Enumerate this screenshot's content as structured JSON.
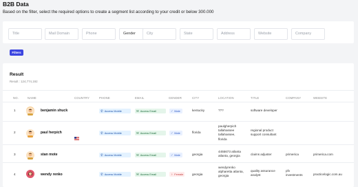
{
  "header": {
    "title": "B2B Data",
    "subtitle": "Based on the filter, select the required options to create a segment list according to your credit or below 300.000"
  },
  "filters": {
    "title": "Title",
    "mail_domain": "Mail Domain",
    "phone": "Phone",
    "gender": "Gender",
    "city": "City",
    "state": "State",
    "address": "Address",
    "website": "Website",
    "company": "Company",
    "button": "Filters"
  },
  "result": {
    "title": "Result",
    "count": "Result : 124,774,192"
  },
  "columns": {
    "no": "NO.",
    "name": "NAME",
    "country": "COUNTRY",
    "phone": "PHONE",
    "email": "EMAIL",
    "gender": "GENDER",
    "city": "CITY",
    "location": "LOCATION",
    "title": "TITLE",
    "company": "COMPANY",
    "website": "WEBSITE"
  },
  "badges": {
    "mobile": "Access Mobile",
    "email": "Access Email",
    "male": "Male",
    "female": "Female"
  },
  "rows": [
    {
      "no": "1",
      "name": "benjamin shuck",
      "city": "kentucky",
      "loc1": "???",
      "loc2": "",
      "loc3": "",
      "title1": "software developer",
      "title2": "",
      "company1": "",
      "company2": "",
      "website": "",
      "gender": "male"
    },
    {
      "no": "2",
      "name": "paul herpich",
      "city": "florida",
      "loc1": "paulgherpich",
      "loc2": "tallahassee",
      "loc3": "tallahassee,",
      "loc4": "florida",
      "title1": "regional product",
      "title2": "support consultant",
      "company1": "",
      "company2": "",
      "website": "",
      "gender": "male"
    },
    {
      "no": "3",
      "name": "stan mote",
      "city": "georgia",
      "loc1": "4455673 atlanta",
      "loc2": "atlanta, georgia",
      "loc3": "",
      "title1": "claims adjuster",
      "title2": "",
      "company1": "primerica",
      "company2": "",
      "website": "primerica.com",
      "gender": "male"
    },
    {
      "no": "4",
      "name": "wendy renko",
      "city": "georgia",
      "loc1": "wendyrenko",
      "loc2": "alpharetta atlanta,",
      "loc3": "georgia",
      "title1": "quality assurance",
      "title2": "analyst",
      "company1": "pfv",
      "company2": "investments",
      "website": "practicelogic.com.au",
      "gender": "female"
    }
  ],
  "colors": {
    "accent": "#3b45e0",
    "mobile_bg": "#e3f2ff",
    "email_bg": "#e4f5ea",
    "female": "#c43a3a"
  }
}
